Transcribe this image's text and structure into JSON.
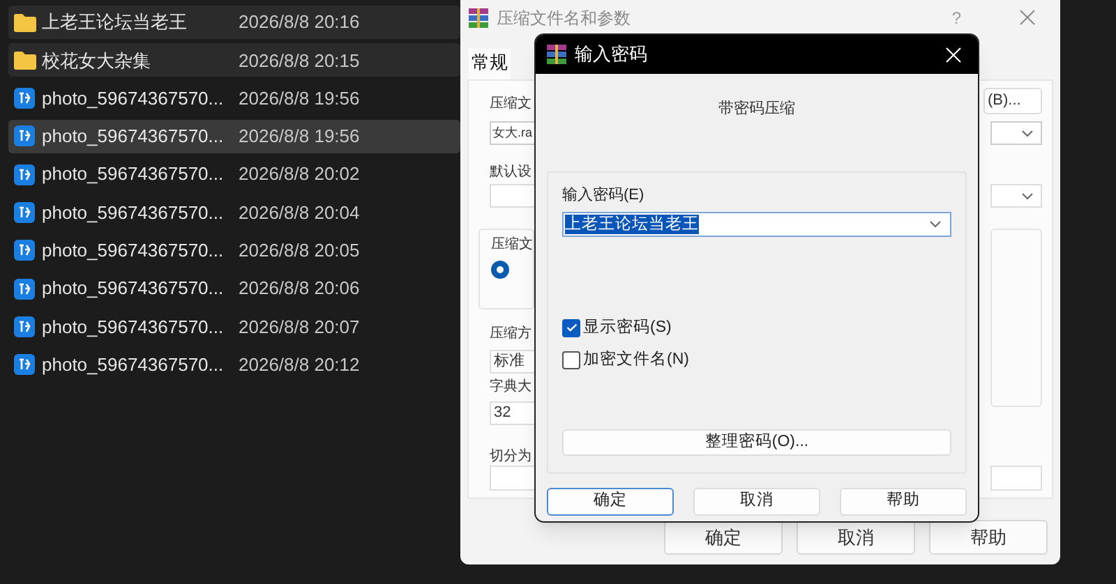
{
  "file_list": {
    "rows": [
      {
        "kind": "folder",
        "name": "上老王论坛当老王",
        "modified": "2026/8/8 20:16",
        "highlighted": true,
        "selected": false
      },
      {
        "kind": "folder",
        "name": "校花女大杂集",
        "modified": "2026/8/8 20:15",
        "highlighted": true,
        "selected": false
      },
      {
        "kind": "image",
        "name": "photo_59674367570...",
        "modified": "2026/8/8 19:56",
        "highlighted": false,
        "selected": false
      },
      {
        "kind": "image",
        "name": "photo_59674367570...",
        "modified": "2026/8/8 19:56",
        "highlighted": false,
        "selected": true
      },
      {
        "kind": "image",
        "name": "photo_59674367570...",
        "modified": "2026/8/8 20:02",
        "highlighted": false,
        "selected": false
      },
      {
        "kind": "image",
        "name": "photo_59674367570...",
        "modified": "2026/8/8 20:04",
        "highlighted": false,
        "selected": false
      },
      {
        "kind": "image",
        "name": "photo_59674367570...",
        "modified": "2026/8/8 20:05",
        "highlighted": false,
        "selected": false
      },
      {
        "kind": "image",
        "name": "photo_59674367570...",
        "modified": "2026/8/8 20:06",
        "highlighted": false,
        "selected": false
      },
      {
        "kind": "image",
        "name": "photo_59674367570...",
        "modified": "2026/8/8 20:07",
        "highlighted": false,
        "selected": false
      },
      {
        "kind": "image",
        "name": "photo_59674367570...",
        "modified": "2026/8/8 20:12",
        "highlighted": false,
        "selected": false
      }
    ]
  },
  "archive_dialog": {
    "title": "压缩文件名和参数",
    "help": "?",
    "tabs": [
      {
        "label": "常规",
        "selected": true
      }
    ],
    "archive_name_label": "压缩文",
    "browse_button": "(B)...",
    "archive_name": "女大.ra",
    "profile_label": "默认设",
    "format_group": {
      "label": "压缩文",
      "radio_checked": true
    },
    "method_label": "压缩方",
    "method": "标准",
    "dictionary_label": "字典大",
    "dictionary": "32",
    "split_label": "切分为",
    "buttons": [
      "确定",
      "取消",
      "帮助"
    ]
  },
  "password_dialog": {
    "title": "输入密码",
    "heading": "带密码压缩",
    "password_label": "输入密码(E)",
    "password": "上老王论坛当老王",
    "password_selected": true,
    "options": [
      {
        "label": "显示密码(S)",
        "checked": true
      },
      {
        "label": "加密文件名(N)",
        "checked": false
      }
    ],
    "organize_button": "整理密码(O)...",
    "buttons": [
      {
        "label": "确定",
        "focused": true
      },
      {
        "label": "取消",
        "focused": false
      },
      {
        "label": "帮助",
        "focused": false
      }
    ]
  }
}
